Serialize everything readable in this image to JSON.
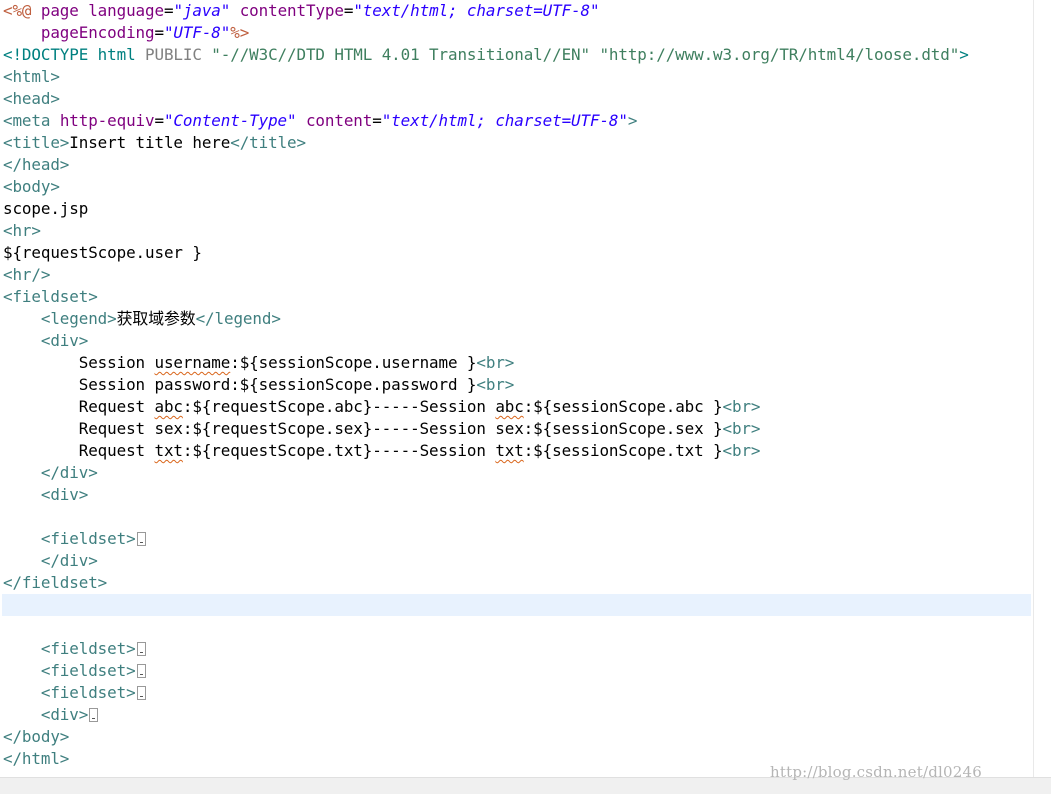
{
  "editor": {
    "lines": [
      [
        {
          "c": "jsp",
          "t": "<%@ "
        },
        {
          "c": "attr",
          "t": "page "
        },
        {
          "c": "attr",
          "t": "language"
        },
        {
          "c": "text",
          "t": "="
        },
        {
          "c": "val",
          "t": "\"java\""
        },
        {
          "c": "text",
          "t": " "
        },
        {
          "c": "attr",
          "t": "contentType"
        },
        {
          "c": "text",
          "t": "="
        },
        {
          "c": "val",
          "t": "\"text/html; charset=UTF-8\""
        }
      ],
      [
        {
          "c": "text",
          "t": "    "
        },
        {
          "c": "attr",
          "t": "pageEncoding"
        },
        {
          "c": "text",
          "t": "="
        },
        {
          "c": "val",
          "t": "\"UTF-8\""
        },
        {
          "c": "jsp",
          "t": "%>"
        }
      ],
      [
        {
          "c": "dt",
          "t": "<!DOCTYPE html "
        },
        {
          "c": "dk",
          "t": "PUBLIC "
        },
        {
          "c": "dv",
          "t": "\"-//W3C//DTD HTML 4.01 Transitional//EN\" \"http://www.w3.org/TR/html4/loose.dtd\""
        },
        {
          "c": "dt",
          "t": ">"
        }
      ],
      [
        {
          "c": "tag",
          "t": "<html>"
        }
      ],
      [
        {
          "c": "tag",
          "t": "<head>"
        }
      ],
      [
        {
          "c": "tag",
          "t": "<meta "
        },
        {
          "c": "attr",
          "t": "http-equiv"
        },
        {
          "c": "text",
          "t": "="
        },
        {
          "c": "val",
          "t": "\"Content-Type\""
        },
        {
          "c": "text",
          "t": " "
        },
        {
          "c": "attr",
          "t": "content"
        },
        {
          "c": "text",
          "t": "="
        },
        {
          "c": "val",
          "t": "\"text/html; charset=UTF-8\""
        },
        {
          "c": "tag",
          "t": ">"
        }
      ],
      [
        {
          "c": "tag",
          "t": "<title>"
        },
        {
          "c": "text",
          "t": "Insert title here"
        },
        {
          "c": "tag",
          "t": "</title>"
        }
      ],
      [
        {
          "c": "tag",
          "t": "</head>"
        }
      ],
      [
        {
          "c": "tag",
          "t": "<body>"
        }
      ],
      [
        {
          "c": "text",
          "t": "scope.jsp"
        }
      ],
      [
        {
          "c": "tag",
          "t": "<hr>"
        }
      ],
      [
        {
          "c": "text",
          "t": "${requestScope.user }"
        }
      ],
      [
        {
          "c": "tag",
          "t": "<hr/>"
        }
      ],
      [
        {
          "c": "tag",
          "t": "<fieldset>"
        }
      ],
      [
        {
          "c": "text",
          "t": "    "
        },
        {
          "c": "tag",
          "t": "<legend>"
        },
        {
          "c": "text",
          "t": "获取域参数"
        },
        {
          "c": "tag",
          "t": "</legend>"
        }
      ],
      [
        {
          "c": "text",
          "t": "    "
        },
        {
          "c": "tag",
          "t": "<div>"
        }
      ],
      [
        {
          "c": "text",
          "t": "        Session "
        },
        {
          "c": "typo",
          "t": "username"
        },
        {
          "c": "text",
          "t": ":${sessionScope.username }"
        },
        {
          "c": "tag",
          "t": "<br>"
        }
      ],
      [
        {
          "c": "text",
          "t": "        Session password:${sessionScope.password }"
        },
        {
          "c": "tag",
          "t": "<br>"
        }
      ],
      [
        {
          "c": "text",
          "t": "        Request "
        },
        {
          "c": "typo",
          "t": "abc"
        },
        {
          "c": "text",
          "t": ":${requestScope.abc}-----Session "
        },
        {
          "c": "typo",
          "t": "abc"
        },
        {
          "c": "text",
          "t": ":${sessionScope.abc }"
        },
        {
          "c": "tag",
          "t": "<br>"
        }
      ],
      [
        {
          "c": "text",
          "t": "        Request sex:${requestScope.sex}-----Session sex:${sessionScope.sex }"
        },
        {
          "c": "tag",
          "t": "<br>"
        }
      ],
      [
        {
          "c": "text",
          "t": "        Request "
        },
        {
          "c": "typo",
          "t": "txt"
        },
        {
          "c": "text",
          "t": ":${requestScope.txt}-----Session "
        },
        {
          "c": "typo",
          "t": "txt"
        },
        {
          "c": "text",
          "t": ":${sessionScope.txt }"
        },
        {
          "c": "tag",
          "t": "<br>"
        }
      ],
      [
        {
          "c": "text",
          "t": "    "
        },
        {
          "c": "tag",
          "t": "</div>"
        }
      ],
      [
        {
          "c": "text",
          "t": "    "
        },
        {
          "c": "tag",
          "t": "<div>"
        }
      ],
      [],
      [
        {
          "c": "text",
          "t": "    "
        },
        {
          "c": "tag",
          "t": "<fieldset>"
        },
        {
          "c": "fold",
          "t": ""
        }
      ],
      [
        {
          "c": "text",
          "t": "    "
        },
        {
          "c": "tag",
          "t": "</div>"
        }
      ],
      [
        {
          "c": "tag",
          "t": "</fieldset>"
        }
      ],
      [],
      [],
      [
        {
          "c": "text",
          "t": "    "
        },
        {
          "c": "tag",
          "t": "<fieldset>"
        },
        {
          "c": "fold",
          "t": ""
        }
      ],
      [
        {
          "c": "text",
          "t": "    "
        },
        {
          "c": "tag",
          "t": "<fieldset>"
        },
        {
          "c": "fold",
          "t": ""
        }
      ],
      [
        {
          "c": "text",
          "t": "    "
        },
        {
          "c": "tag",
          "t": "<fieldset>"
        },
        {
          "c": "fold",
          "t": ""
        }
      ],
      [
        {
          "c": "text",
          "t": "    "
        },
        {
          "c": "tag",
          "t": "<div>"
        },
        {
          "c": "fold",
          "t": ""
        }
      ],
      [
        {
          "c": "tag",
          "t": "</body>"
        }
      ],
      [
        {
          "c": "tag",
          "t": "</html>"
        }
      ]
    ]
  },
  "watermark": "http://blog.csdn.net/dl0246",
  "colors": {
    "tag": "#3f7f7f",
    "jsp": "#bf5f3f",
    "attr": "#7f007f",
    "value": "#2a00ff",
    "doctype": "#008080",
    "text": "#000000",
    "current_line": "#e8f2fe",
    "spell_underline": "#d9651a"
  }
}
